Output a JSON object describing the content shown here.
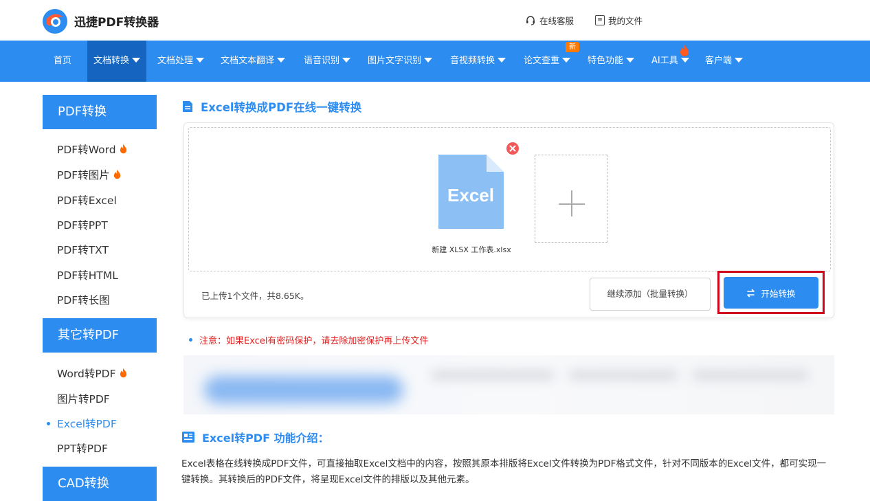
{
  "header": {
    "brand": "迅捷PDF转换器",
    "service_link": "在线客服",
    "files_link": "我的文件"
  },
  "nav": {
    "items": [
      {
        "label": "首页",
        "dropdown": false
      },
      {
        "label": "文档转换",
        "dropdown": true,
        "active": true
      },
      {
        "label": "文档处理",
        "dropdown": true
      },
      {
        "label": "文档文本翻译",
        "dropdown": true
      },
      {
        "label": "语音识别",
        "dropdown": true
      },
      {
        "label": "图片文字识别",
        "dropdown": true
      },
      {
        "label": "音视频转换",
        "dropdown": true
      },
      {
        "label": "论文查重",
        "dropdown": true
      },
      {
        "label": "特色功能",
        "dropdown": true
      },
      {
        "label": "AI工具",
        "dropdown": true
      },
      {
        "label": "客户端",
        "dropdown": true
      }
    ],
    "new_badge": "新",
    "accent_color": "#2d8cf0",
    "active_color": "#1565c0"
  },
  "sidebar": {
    "sections": [
      {
        "heading": "PDF转换",
        "items": [
          {
            "label": "PDF转Word",
            "hot": true
          },
          {
            "label": "PDF转图片",
            "hot": true
          },
          {
            "label": "PDF转Excel",
            "hot": false
          },
          {
            "label": "PDF转PPT",
            "hot": false
          },
          {
            "label": "PDF转TXT",
            "hot": false
          },
          {
            "label": "PDF转HTML",
            "hot": false
          },
          {
            "label": "PDF转长图",
            "hot": false
          }
        ]
      },
      {
        "heading": "其它转PDF",
        "items": [
          {
            "label": "Word转PDF",
            "hot": true
          },
          {
            "label": "图片转PDF",
            "hot": false
          },
          {
            "label": "Excel转PDF",
            "hot": false,
            "current": true
          },
          {
            "label": "PPT转PDF",
            "hot": false
          }
        ]
      },
      {
        "heading": "CAD转换",
        "items": []
      }
    ]
  },
  "main": {
    "title": "Excel转换成PDF在线一键转换",
    "file": {
      "icon_label": "Excel",
      "name": "新建 XLSX 工作表.xlsx"
    },
    "upload_status": "已上传1个文件，共8.65K。",
    "add_more_label": "继续添加（批量转换）",
    "start_label": "开始转换",
    "notice": "注意：如果Excel有密码保护，请去除加密保护再上传文件",
    "intro_title": "Excel转PDF 功能介绍：",
    "intro_text": "Excel表格在线转换成PDF文件，可直接抽取Excel文档中的内容，按照其原本排版将Excel文件转换为PDF格式文件，针对不同版本的Excel文件，都可实现一键转换。其转换后的PDF文件，将呈现Excel文件的排版以及其他元素。"
  },
  "icons": {
    "logo": "brand-logo-icon",
    "service": "headset-icon",
    "files": "document-icon",
    "hot": "flame-icon",
    "remove": "close-circle-icon",
    "add": "plus-icon",
    "start": "swap-arrows-icon",
    "title": "file-icon",
    "intro": "info-doc-icon"
  },
  "colors": {
    "highlight_frame": "#d0021b",
    "notice": "#e02020",
    "excel_file": "#8cc0f5",
    "hot": "#ff6a00"
  }
}
